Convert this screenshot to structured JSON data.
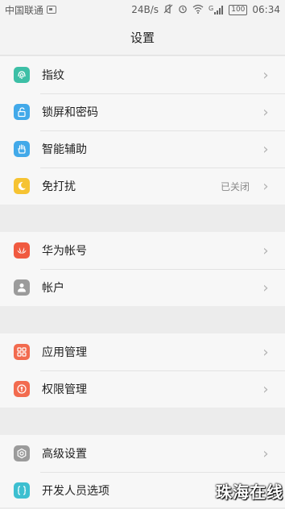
{
  "status_bar": {
    "carrier": "中国联通",
    "speed": "24B/s",
    "signal_label": "G",
    "battery": "100",
    "time": "06:34"
  },
  "header": {
    "title": "设置"
  },
  "groups": [
    {
      "items": [
        {
          "label": "指纹",
          "icon": "fingerprint-icon",
          "color": "#3dbfa6"
        },
        {
          "label": "锁屏和密码",
          "icon": "unlock-icon",
          "color": "#42a9e9"
        },
        {
          "label": "智能辅助",
          "icon": "hand-icon",
          "color": "#42a9e9"
        },
        {
          "label": "免打扰",
          "icon": "moon-icon",
          "color": "#f6c332",
          "value": "已关闭"
        }
      ]
    },
    {
      "items": [
        {
          "label": "华为帐号",
          "icon": "huawei-icon",
          "color": "#f05a40"
        },
        {
          "label": "帐户",
          "icon": "person-icon",
          "color": "#9b9b9b"
        }
      ]
    },
    {
      "items": [
        {
          "label": "应用管理",
          "icon": "apps-grid-icon",
          "color": "#f26b4f"
        },
        {
          "label": "权限管理",
          "icon": "permission-icon",
          "color": "#f26b4f"
        }
      ]
    },
    {
      "items": [
        {
          "label": "高级设置",
          "icon": "gear-icon",
          "color": "#9b9b9b"
        },
        {
          "label": "开发人员选项",
          "icon": "code-braces-icon",
          "color": "#3dbfd0"
        }
      ]
    }
  ],
  "watermark": "珠海在线"
}
